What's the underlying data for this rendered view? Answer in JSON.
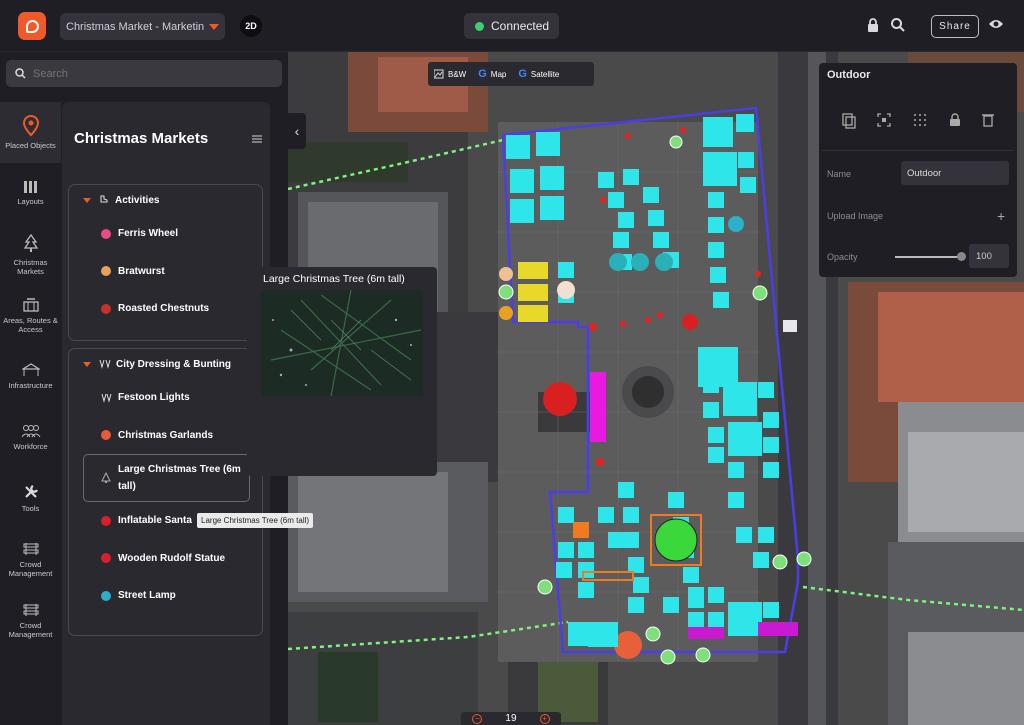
{
  "topbar": {
    "project_name": "Christmas Market - Marketin",
    "view_mode": "2D",
    "status": "Connected",
    "share_label": "Share"
  },
  "search": {
    "placeholder": "Search"
  },
  "rail": [
    {
      "label": "Placed Objects",
      "icon": "location-pin-icon"
    },
    {
      "label": "Layouts",
      "icon": "layouts-icon"
    },
    {
      "label": "Christmas Markets",
      "icon": "christmas-tree-icon"
    },
    {
      "label": "Areas, Routes & Access",
      "icon": "gate-icon"
    },
    {
      "label": "Infrastructure",
      "icon": "tent-icon"
    },
    {
      "label": "Workforce",
      "icon": "people-icon"
    },
    {
      "label": "Tools",
      "icon": "wrench-icon"
    },
    {
      "label": "Crowd Management",
      "icon": "barrier-icon"
    },
    {
      "label": "Crowd Management",
      "icon": "barrier-icon"
    }
  ],
  "category": {
    "title": "Christmas Markets",
    "groups": [
      {
        "name": "Activities",
        "items": [
          {
            "label": "Ferris Wheel",
            "color": "#e84a8a"
          },
          {
            "label": "Bratwurst",
            "color": "#e8a05a"
          },
          {
            "label": "Roasted Chestnuts",
            "color": "#c8302a"
          }
        ]
      },
      {
        "name": "City Dressing & Bunting",
        "items": [
          {
            "label": "Festoon Lights",
            "color": "#dddddd"
          },
          {
            "label": "Christmas Garlands",
            "color": "#e85a3a"
          },
          {
            "label": "Large Christmas Tree (6m tall)",
            "color": "#888888"
          },
          {
            "label": "Inflatable Santa",
            "color": "#d8202a"
          },
          {
            "label": "Wooden Rudolf Statue",
            "color": "#d8202a"
          },
          {
            "label": "Street Lamp",
            "color": "#2ab0c8"
          }
        ]
      }
    ]
  },
  "preview": {
    "title": "Large Christmas Tree (6m tall)",
    "tooltip": "Large Christmas Tree (6m tall)"
  },
  "map": {
    "layers": [
      "B&W",
      "Map",
      "Satellite"
    ],
    "zoom": "19"
  },
  "properties": {
    "title": "Outdoor",
    "name_label": "Name",
    "name_value": "Outdoor",
    "upload_label": "Upload Image",
    "opacity_label": "Opacity",
    "opacity_value": "100"
  }
}
